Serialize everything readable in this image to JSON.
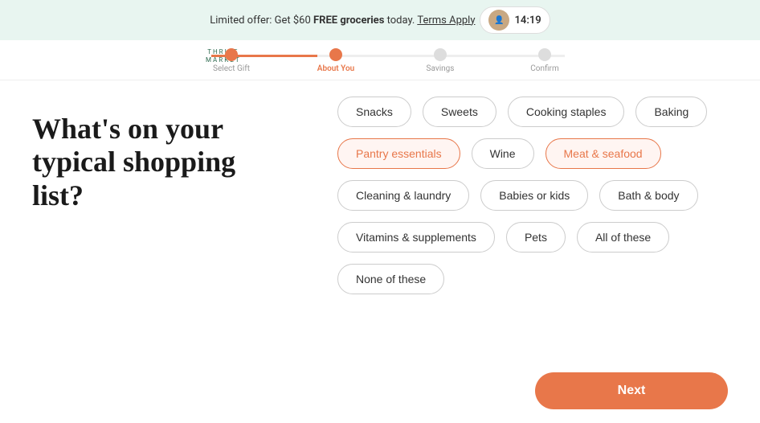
{
  "banner": {
    "text_prefix": "Limited offer: Get $60 ",
    "text_bold": "FREE groceries",
    "text_suffix": " today. ",
    "link_text": "Terms Apply",
    "timer": "14:19"
  },
  "progress": {
    "logo_line1": "THRIVE",
    "logo_line2": "MARKET",
    "steps": [
      {
        "label": "Select Gift",
        "state": "completed"
      },
      {
        "label": "About You",
        "state": "active"
      },
      {
        "label": "Savings",
        "state": "inactive"
      },
      {
        "label": "Confirm",
        "state": "inactive"
      }
    ]
  },
  "heading": "What's on your typical shopping list?",
  "options": [
    {
      "id": "snacks",
      "label": "Snacks",
      "selected": false
    },
    {
      "id": "sweets",
      "label": "Sweets",
      "selected": false
    },
    {
      "id": "cooking-staples",
      "label": "Cooking staples",
      "selected": false
    },
    {
      "id": "baking",
      "label": "Baking",
      "selected": false
    },
    {
      "id": "pantry-essentials",
      "label": "Pantry essentials",
      "selected": true
    },
    {
      "id": "wine",
      "label": "Wine",
      "selected": false
    },
    {
      "id": "meat-seafood",
      "label": "Meat & seafood",
      "selected": true
    },
    {
      "id": "cleaning-laundry",
      "label": "Cleaning & laundry",
      "selected": false
    },
    {
      "id": "babies-kids",
      "label": "Babies or kids",
      "selected": false
    },
    {
      "id": "bath-body",
      "label": "Bath & body",
      "selected": false
    },
    {
      "id": "vitamins-supplements",
      "label": "Vitamins & supplements",
      "selected": false
    },
    {
      "id": "pets",
      "label": "Pets",
      "selected": false
    },
    {
      "id": "all-of-these",
      "label": "All of these",
      "selected": false
    },
    {
      "id": "none-of-these",
      "label": "None of these",
      "selected": false
    }
  ],
  "next_button": "Next"
}
